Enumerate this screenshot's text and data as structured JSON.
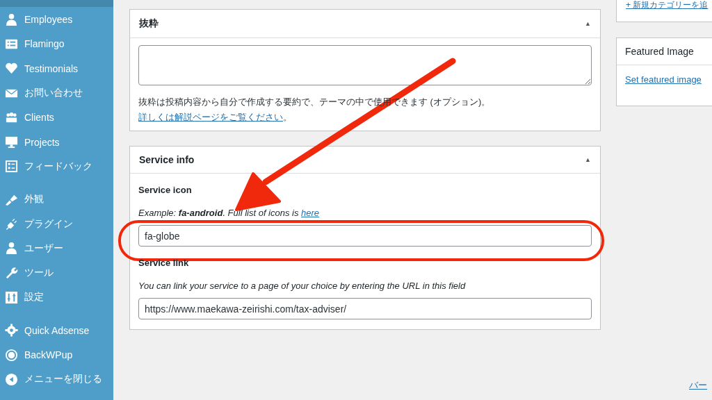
{
  "sidebar": {
    "groups": [
      {
        "items": [
          {
            "label": "Employees"
          },
          {
            "label": "Flamingo"
          },
          {
            "label": "Testimonials"
          },
          {
            "label": "お問い合わせ"
          },
          {
            "label": "Clients"
          },
          {
            "label": "Projects"
          },
          {
            "label": "フィードバック"
          }
        ]
      },
      {
        "items": [
          {
            "label": "外観"
          },
          {
            "label": "プラグイン"
          },
          {
            "label": "ユーザー"
          },
          {
            "label": "ツール"
          },
          {
            "label": "設定"
          }
        ]
      },
      {
        "items": [
          {
            "label": "Quick Adsense"
          },
          {
            "label": "BackWPup"
          },
          {
            "label": "メニューを閉じる"
          }
        ]
      }
    ]
  },
  "excerpt_box": {
    "title": "抜粋",
    "toggle": "▲",
    "expanded": true,
    "help": "抜粋は投稿内容から自分で作成する要約で、テーマの中で使用できます (オプション)。",
    "help_link": "詳しくは解説ページをご覧ください",
    "help_end": "。"
  },
  "service_box": {
    "title": "Service info",
    "toggle": "▲",
    "expanded": true,
    "fields": [
      {
        "label": "Service icon",
        "hint": "Example: **fa-android**. Full list of icons is ",
        "hint_link": "here",
        "value": "fa-globe"
      },
      {
        "label": "Service link",
        "hint": "You can link your service to a page of your choice by entering the URL in this field",
        "value": "https://www.maekawa-zeirishi.com/tax-adviser/"
      }
    ]
  },
  "right_column": {
    "category_link": "+ 新規カテゴリーを追",
    "featured_box": {
      "title": "Featured Image",
      "link": "Set featured image"
    },
    "bottom_link": "バー"
  },
  "annotations": {
    "arrow": true,
    "highlight_ellipse": true
  }
}
